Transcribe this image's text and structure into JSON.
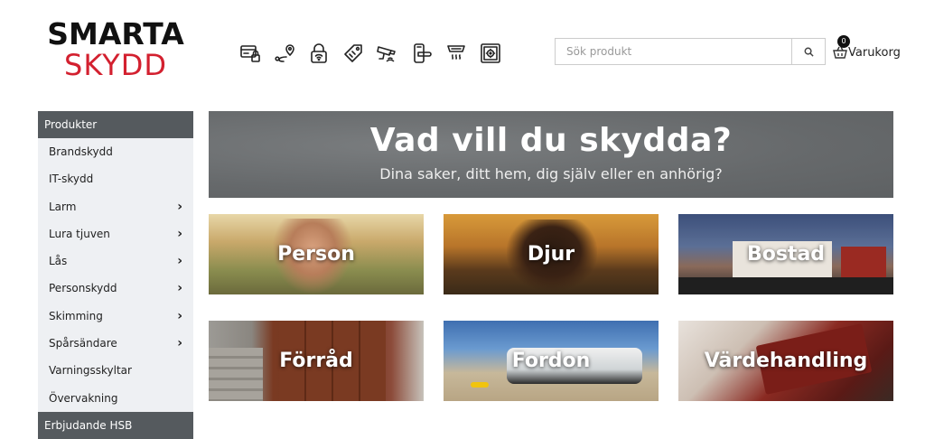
{
  "logo": {
    "line1": "SMARTA",
    "line2": "SKYDD"
  },
  "category_icons": [
    {
      "icon": "card-lock-icon"
    },
    {
      "icon": "location-route-icon"
    },
    {
      "icon": "padlock-wifi-icon"
    },
    {
      "icon": "tag-lock-icon"
    },
    {
      "icon": "security-camera-icon"
    },
    {
      "icon": "door-handle-icon"
    },
    {
      "icon": "smoke-detector-icon"
    },
    {
      "icon": "safe-icon"
    }
  ],
  "search": {
    "placeholder": "Sök produkt",
    "value": ""
  },
  "cart": {
    "label": "Varukorg",
    "count": "0"
  },
  "sidebar": {
    "header": "Produkter",
    "items": [
      {
        "label": "Brandskydd",
        "has_children": false
      },
      {
        "label": "IT-skydd",
        "has_children": false
      },
      {
        "label": "Larm",
        "has_children": true
      },
      {
        "label": "Lura tjuven",
        "has_children": true
      },
      {
        "label": "Lås",
        "has_children": true
      },
      {
        "label": "Personskydd",
        "has_children": true
      },
      {
        "label": "Skimming",
        "has_children": true
      },
      {
        "label": "Spårsändare",
        "has_children": true
      },
      {
        "label": "Varningsskyltar",
        "has_children": false
      },
      {
        "label": "Övervakning",
        "has_children": false
      }
    ],
    "footer": "Erbjudande HSB"
  },
  "banner": {
    "title": "Vad vill du skydda?",
    "subtitle": "Dina saker, ditt hem, dig själv eller en anhörig?"
  },
  "tiles": [
    {
      "label": "Person"
    },
    {
      "label": "Djur"
    },
    {
      "label": "Bostad"
    },
    {
      "label": "Förråd"
    },
    {
      "label": "Fordon"
    },
    {
      "label": "Värdehandling"
    }
  ],
  "colors": {
    "brand_red": "#d3202f",
    "sidebar_header": "#555a5e",
    "sidebar_bg": "#eef0f3",
    "banner_bg": "#6c6f71"
  }
}
